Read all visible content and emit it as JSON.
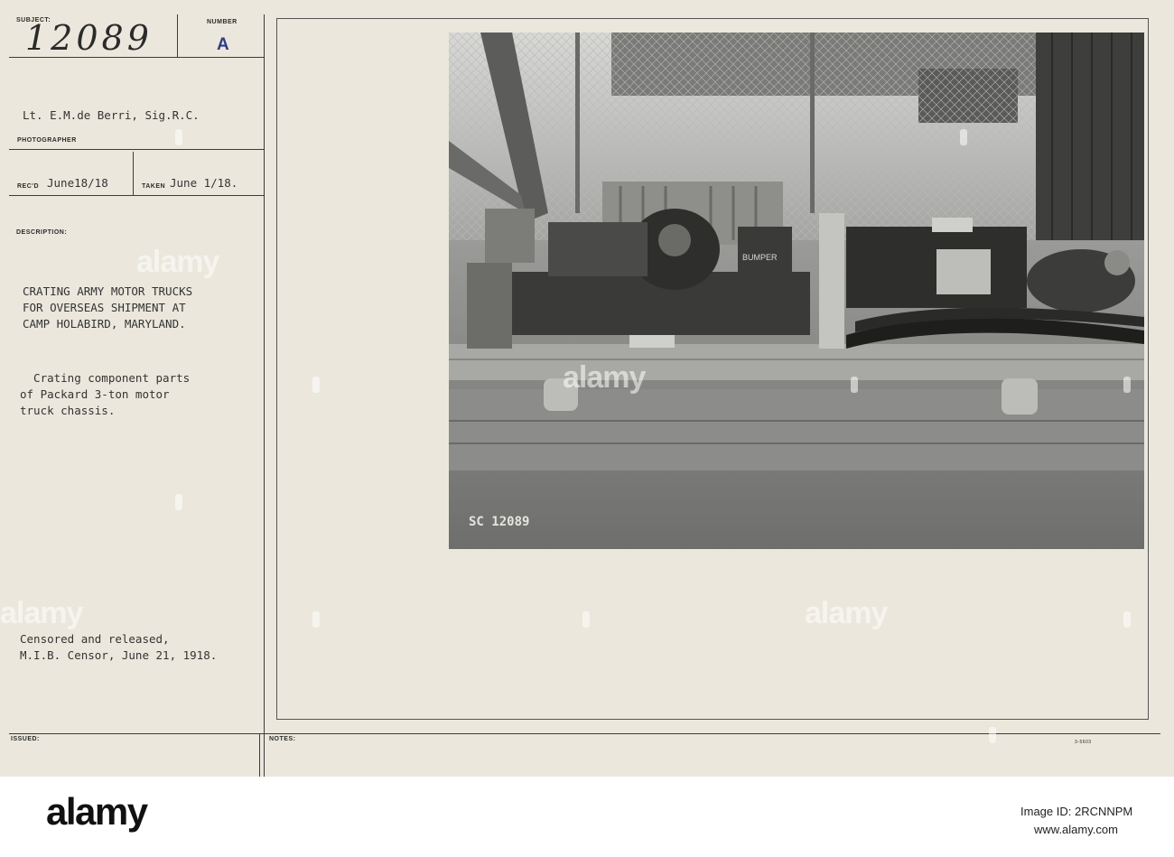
{
  "card": {
    "subject_label": "SUBJECT:",
    "subject_value": "12089",
    "number_label": "NUMBER",
    "number_value": "A",
    "photographer_value": "Lt. E.M.de Berri, Sig.R.C.",
    "photographer_label": "PHOTOGRAPHER",
    "recd_label": "REC'D",
    "recd_value": "June18/18",
    "taken_label": "TAKEN",
    "taken_value": "June 1/18.",
    "description_label": "DESCRIPTION:",
    "description_lines": [
      "CRATING ARMY MOTOR TRUCKS",
      "FOR OVERSEAS SHIPMENT AT",
      "CAMP HOLABIRD, MARYLAND."
    ],
    "caption_lines": [
      "  Crating component parts",
      "of Packard 3-ton motor",
      "truck chassis."
    ],
    "censor_lines": [
      "Censored and released,",
      "M.I.B. Censor, June 21, 1918."
    ],
    "issued_label": "ISSUED:",
    "notes_label": "NOTES:",
    "form_number": "3-5603",
    "negative_number": "SC 12089",
    "crate_label": "BUMPER"
  },
  "watermark": "alamy",
  "footer": {
    "logo": "alamy",
    "image_id": "Image ID: 2RCNNPM",
    "site": "www.alamy.com"
  },
  "colors": {
    "card": "#ebe7dc",
    "stamp_blue": "#2d3c8a",
    "ink": "#333333"
  }
}
